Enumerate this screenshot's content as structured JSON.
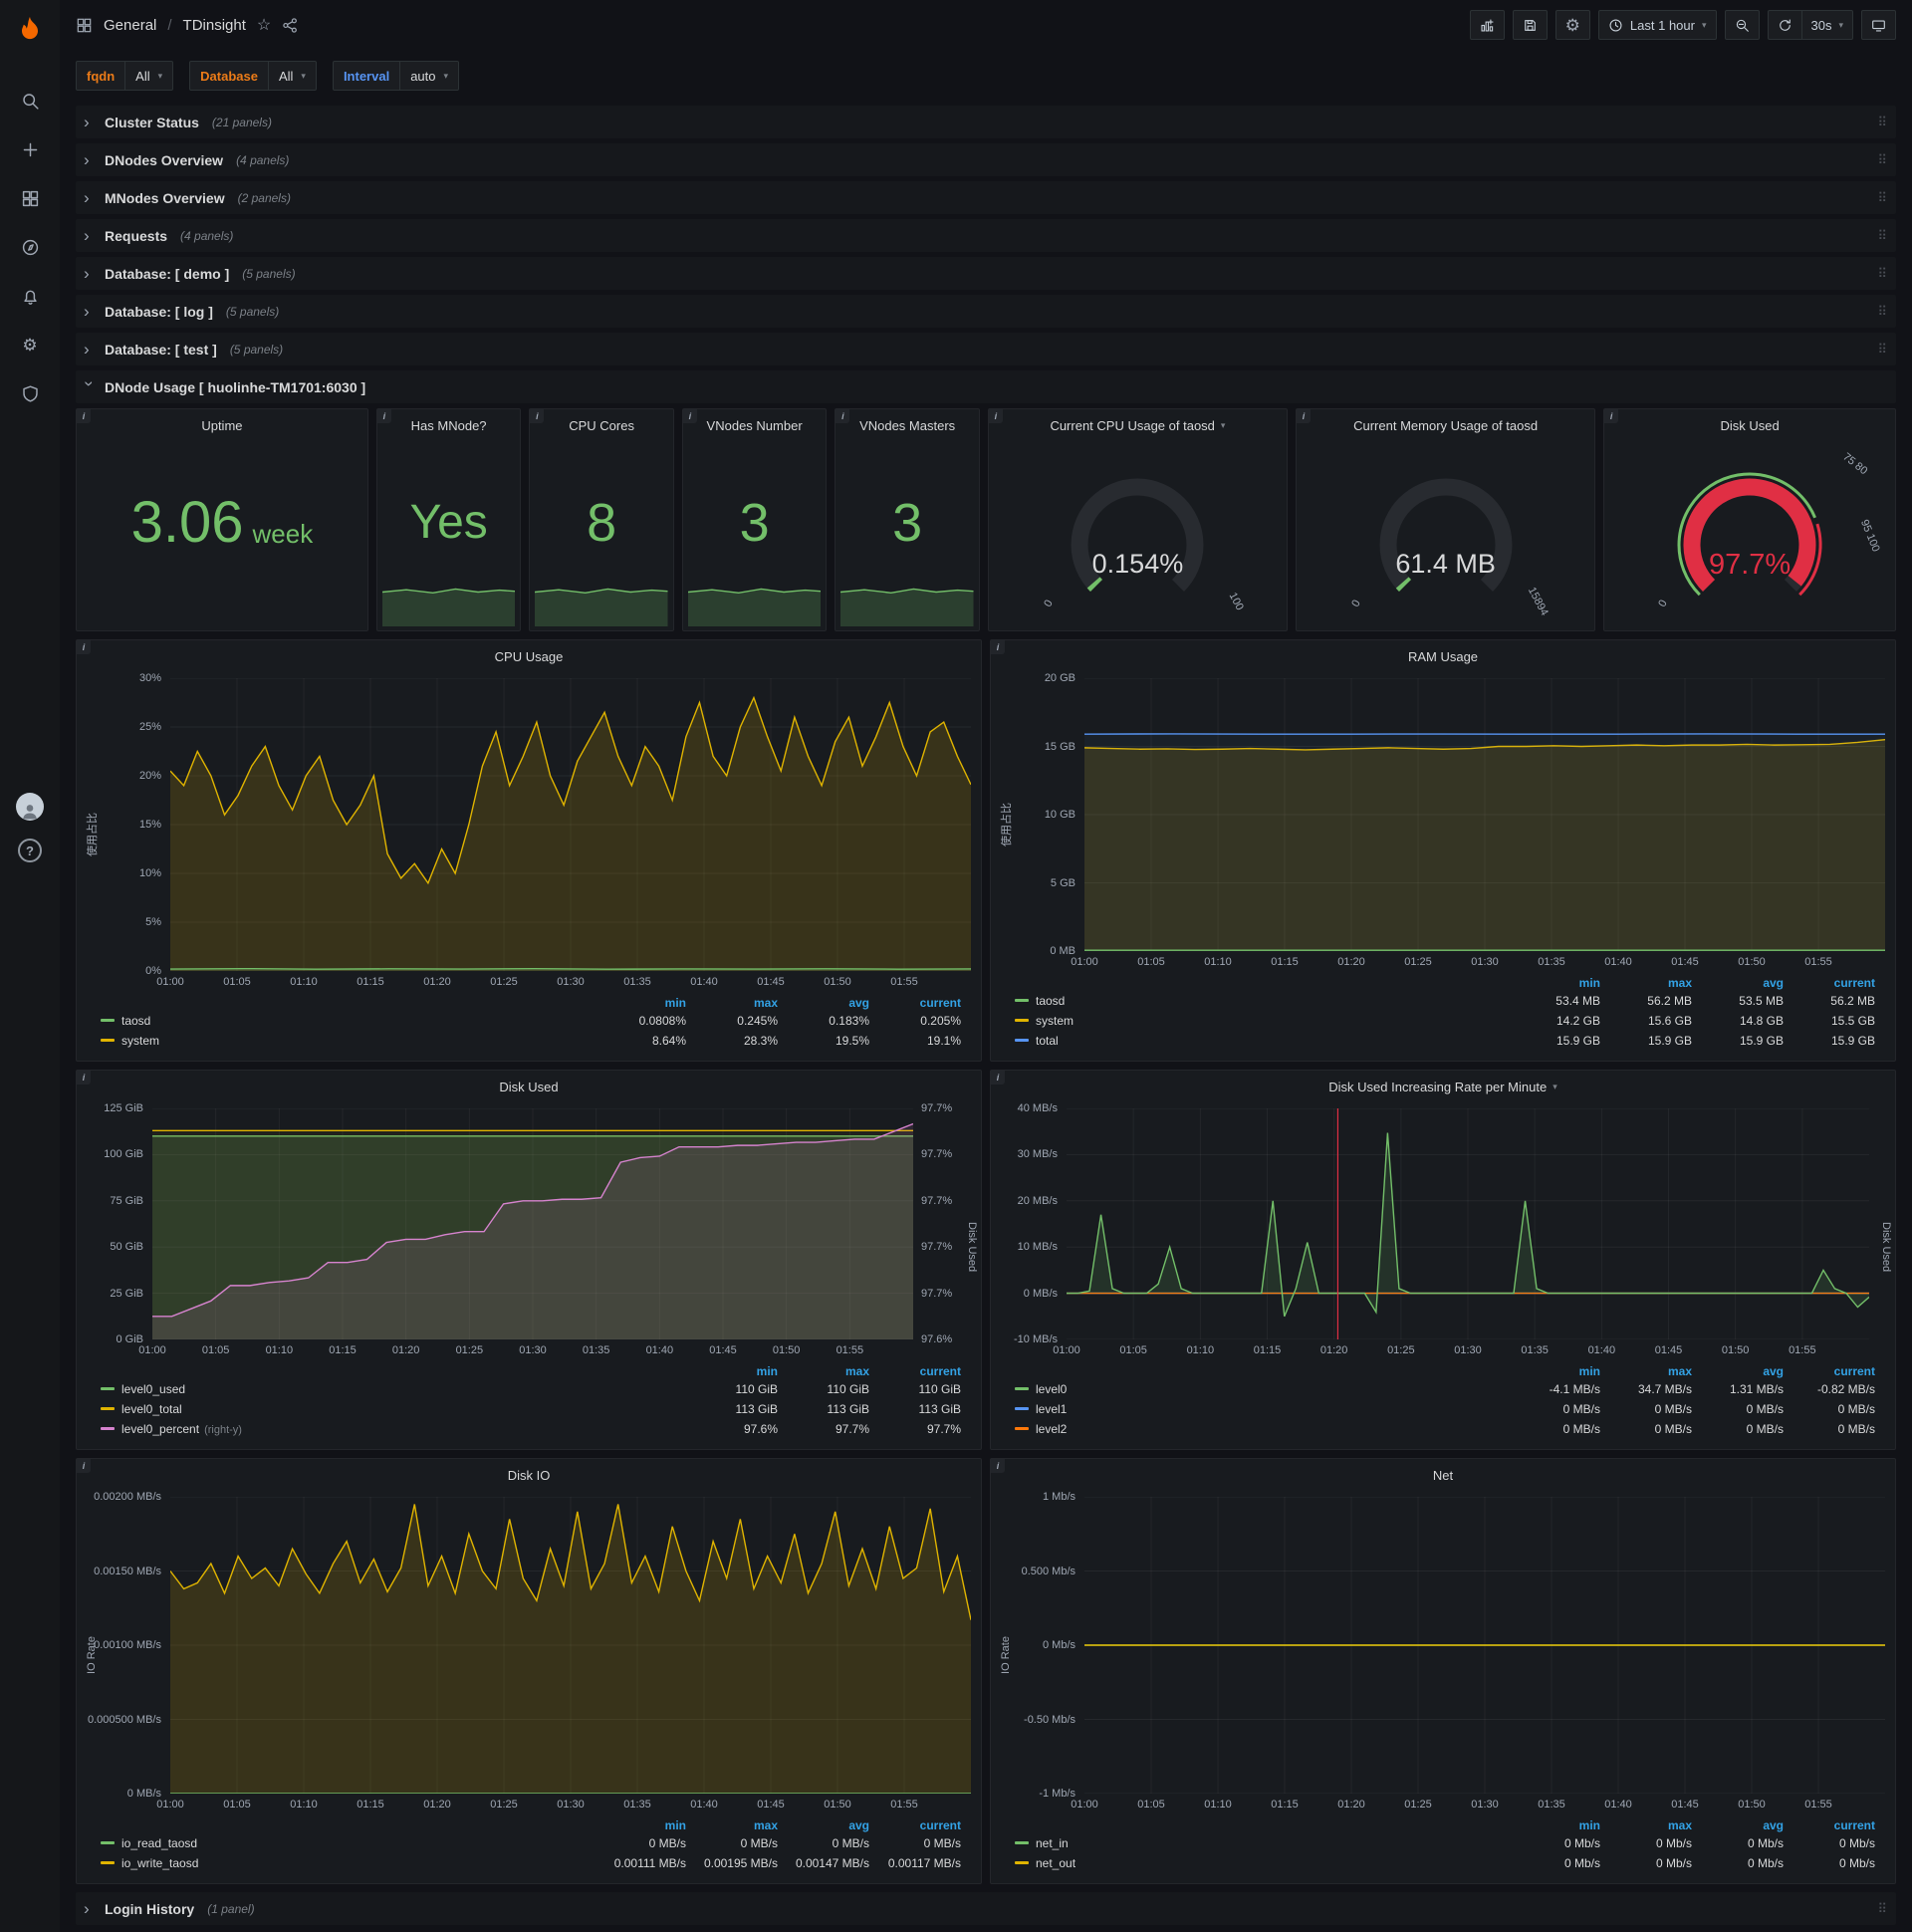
{
  "topnav": {
    "section": "General",
    "separator": "/",
    "page": "TDinsight",
    "time_range": "Last 1 hour",
    "refresh": "30s"
  },
  "variables": [
    {
      "label": "fqdn",
      "value": "All",
      "color": "#eb7b18"
    },
    {
      "label": "Database",
      "value": "All",
      "color": "#eb7b18"
    },
    {
      "label": "Interval",
      "value": "auto",
      "color": "#5794f2"
    }
  ],
  "rows": [
    {
      "title": "Cluster Status",
      "count": "(21 panels)"
    },
    {
      "title": "DNodes Overview",
      "count": "(4 panels)"
    },
    {
      "title": "MNodes Overview",
      "count": "(2 panels)"
    },
    {
      "title": "Requests",
      "count": "(4 panels)"
    },
    {
      "title": "Database: [ demo ]",
      "count": "(5 panels)"
    },
    {
      "title": "Database: [ log ]",
      "count": "(5 panels)"
    },
    {
      "title": "Database: [ test ]",
      "count": "(5 panels)"
    }
  ],
  "dnode_row": {
    "title": "DNode Usage [ huolinhe-TM1701:6030 ]"
  },
  "login_row": {
    "title": "Login History",
    "count": "(1 panel)"
  },
  "stats": [
    {
      "title": "Uptime",
      "value": "3.06",
      "unit": "week"
    },
    {
      "title": "Has MNode?",
      "value": "Yes"
    },
    {
      "title": "CPU Cores",
      "value": "8"
    },
    {
      "title": "VNodes Number",
      "value": "3"
    },
    {
      "title": "VNodes Masters",
      "value": "3"
    }
  ],
  "gauges": [
    {
      "title": "Current CPU Usage of taosd",
      "value": "0.154%",
      "min_label": "0",
      "max_label": "100",
      "fraction": 0.0154,
      "color": "#73bf69",
      "menu": true
    },
    {
      "title": "Current Memory Usage of taosd",
      "value": "61.4 MB",
      "min_label": "0",
      "max_label": "15894",
      "fraction": 0.004,
      "color": "#73bf69"
    },
    {
      "title": "Disk Used",
      "value": "97.7%",
      "min_label": "0",
      "max_label": "",
      "fraction": 0.977,
      "color": "#e02f44",
      "threshold_band": true,
      "threshold_labels": [
        "75 80",
        "95 100"
      ]
    }
  ],
  "icons": {
    "info": "i",
    "caret": "▾",
    "chevron": "›",
    "drag": "⠿",
    "star": "☆",
    "gear": "⚙",
    "help": "?"
  },
  "charts": {
    "cpu": {
      "title": "CPU Usage",
      "type": "line",
      "ylabel": "使用占比",
      "ylim": [
        0,
        30
      ],
      "yticks": [
        "30%",
        "25%",
        "20%",
        "15%",
        "10%",
        "5%",
        "0%"
      ],
      "xticks": [
        "01:00",
        "01:05",
        "01:10",
        "01:15",
        "01:20",
        "01:25",
        "01:30",
        "01:35",
        "01:40",
        "01:45",
        "01:50",
        "01:55"
      ],
      "series": [
        {
          "name": "system",
          "color": "#e0b400",
          "fill": 0.16,
          "values": [
            20.5,
            19,
            22.5,
            20,
            16,
            18,
            21,
            23,
            19,
            16.5,
            20,
            22,
            17.5,
            15,
            17,
            20,
            12,
            9.5,
            11,
            9,
            12.5,
            10,
            15,
            21,
            24.5,
            19,
            22,
            25.5,
            20,
            17,
            21.5,
            24,
            26.5,
            22,
            19,
            23,
            21,
            17.5,
            24,
            27.5,
            22,
            20,
            25,
            28,
            24,
            20.5,
            26,
            22,
            19,
            23.5,
            26,
            21,
            24,
            27.5,
            23,
            20,
            24.5,
            25.5,
            22,
            19.1
          ]
        },
        {
          "name": "taosd",
          "color": "#73bf69",
          "fill": 0.12,
          "values": [
            0.2,
            0.24,
            0.19,
            0.22,
            0.2,
            0.23,
            0.18,
            0.21,
            0.2,
            0.22,
            0.19,
            0.21
          ]
        }
      ],
      "legend": {
        "columns": [
          "min",
          "max",
          "avg",
          "current"
        ],
        "rows": [
          {
            "name": "taosd",
            "color": "#73bf69",
            "values": [
              "0.0808%",
              "0.245%",
              "0.183%",
              "0.205%"
            ]
          },
          {
            "name": "system",
            "color": "#e0b400",
            "values": [
              "8.64%",
              "28.3%",
              "19.5%",
              "19.1%"
            ]
          }
        ]
      }
    },
    "ram": {
      "title": "RAM Usage",
      "type": "line",
      "ylabel": "使用占比",
      "ylim": [
        0,
        20
      ],
      "yticks": [
        "20 GB",
        "15 GB",
        "10 GB",
        "5 GB",
        "0 MB"
      ],
      "xticks": [
        "01:00",
        "01:05",
        "01:10",
        "01:15",
        "01:20",
        "01:25",
        "01:30",
        "01:35",
        "01:40",
        "01:45",
        "01:50",
        "01:55"
      ],
      "series": [
        {
          "name": "system",
          "color": "#e0b400",
          "fill": 0.14,
          "values": [
            14.9,
            14.85,
            14.8,
            14.82,
            14.78,
            14.8,
            14.85,
            14.8,
            14.75,
            14.8,
            14.85,
            14.9,
            14.85,
            14.8,
            14.85,
            15.0,
            15.0,
            15.05,
            15.0,
            15.05,
            15.1,
            15.05,
            15.1,
            15.1,
            15.15,
            15.1,
            15.12,
            15.15,
            15.3,
            15.5
          ]
        },
        {
          "name": "total",
          "color": "#5794f2",
          "fill": 0.05,
          "values": [
            15.9,
            15.92,
            15.9,
            15.9,
            15.91,
            15.9,
            15.9,
            15.92,
            15.9,
            15.9
          ]
        },
        {
          "name": "taosd",
          "color": "#73bf69",
          "fill": 0.1,
          "values": [
            0.055,
            0.055
          ]
        }
      ],
      "legend": {
        "columns": [
          "min",
          "max",
          "avg",
          "current"
        ],
        "rows": [
          {
            "name": "taosd",
            "color": "#73bf69",
            "values": [
              "53.4 MB",
              "56.2 MB",
              "53.5 MB",
              "56.2 MB"
            ]
          },
          {
            "name": "system",
            "color": "#e0b400",
            "values": [
              "14.2 GB",
              "15.6 GB",
              "14.8 GB",
              "15.5 GB"
            ]
          },
          {
            "name": "total",
            "color": "#5794f2",
            "values": [
              "15.9 GB",
              "15.9 GB",
              "15.9 GB",
              "15.9 GB"
            ]
          }
        ]
      }
    },
    "disk_used": {
      "title": "Disk Used",
      "type": "line",
      "ylabel": "",
      "ylim": [
        0,
        125
      ],
      "yticks": [
        "125 GiB",
        "100 GiB",
        "75 GiB",
        "50 GiB",
        "25 GiB",
        "0 GiB"
      ],
      "right_ylim": [
        97.575,
        97.725
      ],
      "right_yticks": [
        "97.7%",
        "97.7%",
        "97.7%",
        "97.7%",
        "97.7%",
        "97.6%"
      ],
      "right_axis_label": "Disk Used",
      "xticks": [
        "01:00",
        "01:05",
        "01:10",
        "01:15",
        "01:20",
        "01:25",
        "01:30",
        "01:35",
        "01:40",
        "01:45",
        "01:50",
        "01:55"
      ],
      "series": [
        {
          "name": "level0_used",
          "color": "#73bf69",
          "fill": 0.18,
          "values": [
            110,
            110
          ]
        },
        {
          "name": "level0_total",
          "color": "#e0b400",
          "fill": 0.05,
          "values": [
            113,
            113
          ]
        },
        {
          "name": "level0_percent",
          "color": "#d683ce",
          "fill": 0.12,
          "axis": "right",
          "values": [
            97.59,
            97.59,
            97.595,
            97.6,
            97.61,
            97.61,
            97.612,
            97.613,
            97.615,
            97.625,
            97.625,
            97.627,
            97.638,
            97.64,
            97.64,
            97.643,
            97.645,
            97.645,
            97.663,
            97.665,
            97.665,
            97.666,
            97.666,
            97.667,
            97.69,
            97.693,
            97.694,
            97.7,
            97.7,
            97.7,
            97.701,
            97.701,
            97.702,
            97.703,
            97.703,
            97.704,
            97.705,
            97.705,
            97.71,
            97.715
          ]
        }
      ],
      "legend": {
        "columns": [
          "min",
          "max",
          "current"
        ],
        "rows": [
          {
            "name": "level0_used",
            "color": "#73bf69",
            "values": [
              "110 GiB",
              "110 GiB",
              "110 GiB"
            ]
          },
          {
            "name": "level0_total",
            "color": "#e0b400",
            "values": [
              "113 GiB",
              "113 GiB",
              "113 GiB"
            ]
          },
          {
            "name": "level0_percent",
            "color": "#d683ce",
            "note": "(right-y)",
            "values": [
              "97.6%",
              "97.7%",
              "97.7%"
            ]
          }
        ]
      }
    },
    "disk_rate": {
      "title": "Disk Used Increasing Rate per Minute",
      "type": "line",
      "has_menu": true,
      "ylabel": "",
      "ylim": [
        -10,
        40
      ],
      "yticks": [
        "40 MB/s",
        "30 MB/s",
        "20 MB/s",
        "10 MB/s",
        "0 MB/s",
        "-10 MB/s"
      ],
      "right_axis_label": "Disk Used",
      "annotation_frac": 0.338,
      "xticks": [
        "01:00",
        "01:05",
        "01:10",
        "01:15",
        "01:20",
        "01:25",
        "01:30",
        "01:35",
        "01:40",
        "01:45",
        "01:50",
        "01:55"
      ],
      "series": [
        {
          "name": "level1",
          "color": "#5794f2",
          "values": [
            0,
            0
          ]
        },
        {
          "name": "level2",
          "color": "#ff780a",
          "values": [
            0,
            0
          ]
        },
        {
          "name": "level0",
          "color": "#73bf69",
          "fill": 0.14,
          "values": [
            0,
            0,
            0.5,
            17,
            1,
            0,
            0,
            0,
            2,
            10,
            1,
            0,
            0,
            0,
            0,
            0,
            0,
            0,
            20,
            -5,
            1,
            11,
            0,
            0,
            0,
            0,
            0,
            -4.1,
            34.7,
            1,
            0,
            0,
            0,
            0,
            0,
            0,
            0,
            0,
            0,
            0,
            20,
            1,
            0,
            0,
            0,
            0,
            0,
            0,
            0,
            0,
            0,
            0,
            0,
            0,
            0,
            0,
            0,
            0,
            0,
            0,
            0,
            0,
            0,
            0,
            0,
            0,
            5,
            1,
            0,
            -3,
            -0.82
          ]
        }
      ],
      "legend": {
        "columns": [
          "min",
          "max",
          "avg",
          "current"
        ],
        "rows": [
          {
            "name": "level0",
            "color": "#73bf69",
            "values": [
              "-4.1 MB/s",
              "34.7 MB/s",
              "1.31 MB/s",
              "-0.82 MB/s"
            ]
          },
          {
            "name": "level1",
            "color": "#5794f2",
            "values": [
              "0 MB/s",
              "0 MB/s",
              "0 MB/s",
              "0 MB/s"
            ]
          },
          {
            "name": "level2",
            "color": "#ff780a",
            "values": [
              "0 MB/s",
              "0 MB/s",
              "0 MB/s",
              "0 MB/s"
            ]
          }
        ]
      }
    },
    "disk_io": {
      "title": "Disk IO",
      "type": "line",
      "ylabel": "IO Rate",
      "ylim": [
        0,
        0.002
      ],
      "yticks": [
        "0.00200 MB/s",
        "0.00150 MB/s",
        "0.00100 MB/s",
        "0.000500 MB/s",
        "0 MB/s"
      ],
      "xticks": [
        "01:00",
        "01:05",
        "01:10",
        "01:15",
        "01:20",
        "01:25",
        "01:30",
        "01:35",
        "01:40",
        "01:45",
        "01:50",
        "01:55"
      ],
      "series": [
        {
          "name": "io_write_taosd",
          "color": "#e0b400",
          "fill": 0.16,
          "values": [
            0.0015,
            0.00138,
            0.00142,
            0.00155,
            0.00135,
            0.0016,
            0.00145,
            0.00152,
            0.0014,
            0.00165,
            0.00148,
            0.00135,
            0.00155,
            0.0017,
            0.00142,
            0.00158,
            0.00136,
            0.00152,
            0.00195,
            0.0014,
            0.0016,
            0.00135,
            0.00175,
            0.0015,
            0.00138,
            0.00185,
            0.00145,
            0.0013,
            0.00165,
            0.0014,
            0.0019,
            0.00138,
            0.00155,
            0.00195,
            0.00142,
            0.0016,
            0.00136,
            0.0018,
            0.0015,
            0.0013,
            0.0017,
            0.00145,
            0.00185,
            0.00138,
            0.0016,
            0.00142,
            0.00175,
            0.00135,
            0.00155,
            0.0019,
            0.0014,
            0.00165,
            0.00138,
            0.0018,
            0.00145,
            0.00152,
            0.00192,
            0.00136,
            0.0016,
            0.00117
          ]
        },
        {
          "name": "io_read_taosd",
          "color": "#73bf69",
          "values": [
            0,
            0
          ]
        }
      ],
      "legend": {
        "columns": [
          "min",
          "max",
          "avg",
          "current"
        ],
        "rows": [
          {
            "name": "io_read_taosd",
            "color": "#73bf69",
            "values": [
              "0 MB/s",
              "0 MB/s",
              "0 MB/s",
              "0 MB/s"
            ]
          },
          {
            "name": "io_write_taosd",
            "color": "#e0b400",
            "values": [
              "0.00111 MB/s",
              "0.00195 MB/s",
              "0.00147 MB/s",
              "0.00117 MB/s"
            ]
          }
        ]
      }
    },
    "net": {
      "title": "Net",
      "type": "line",
      "ylabel": "IO Rate",
      "ylim": [
        -1,
        1
      ],
      "yticks": [
        "1 Mb/s",
        "0.500 Mb/s",
        "0 Mb/s",
        "-0.50 Mb/s",
        "-1 Mb/s"
      ],
      "xticks": [
        "01:00",
        "01:05",
        "01:10",
        "01:15",
        "01:20",
        "01:25",
        "01:30",
        "01:35",
        "01:40",
        "01:45",
        "01:50",
        "01:55"
      ],
      "series": [
        {
          "name": "net_in",
          "color": "#73bf69",
          "values": [
            0,
            0
          ]
        },
        {
          "name": "net_out",
          "color": "#e0b400",
          "values": [
            0,
            0
          ]
        }
      ],
      "legend": {
        "columns": [
          "min",
          "max",
          "avg",
          "current"
        ],
        "rows": [
          {
            "name": "net_in",
            "color": "#73bf69",
            "values": [
              "0 Mb/s",
              "0 Mb/s",
              "0 Mb/s",
              "0 Mb/s"
            ]
          },
          {
            "name": "net_out",
            "color": "#e0b400",
            "values": [
              "0 Mb/s",
              "0 Mb/s",
              "0 Mb/s",
              "0 Mb/s"
            ]
          }
        ]
      }
    }
  }
}
